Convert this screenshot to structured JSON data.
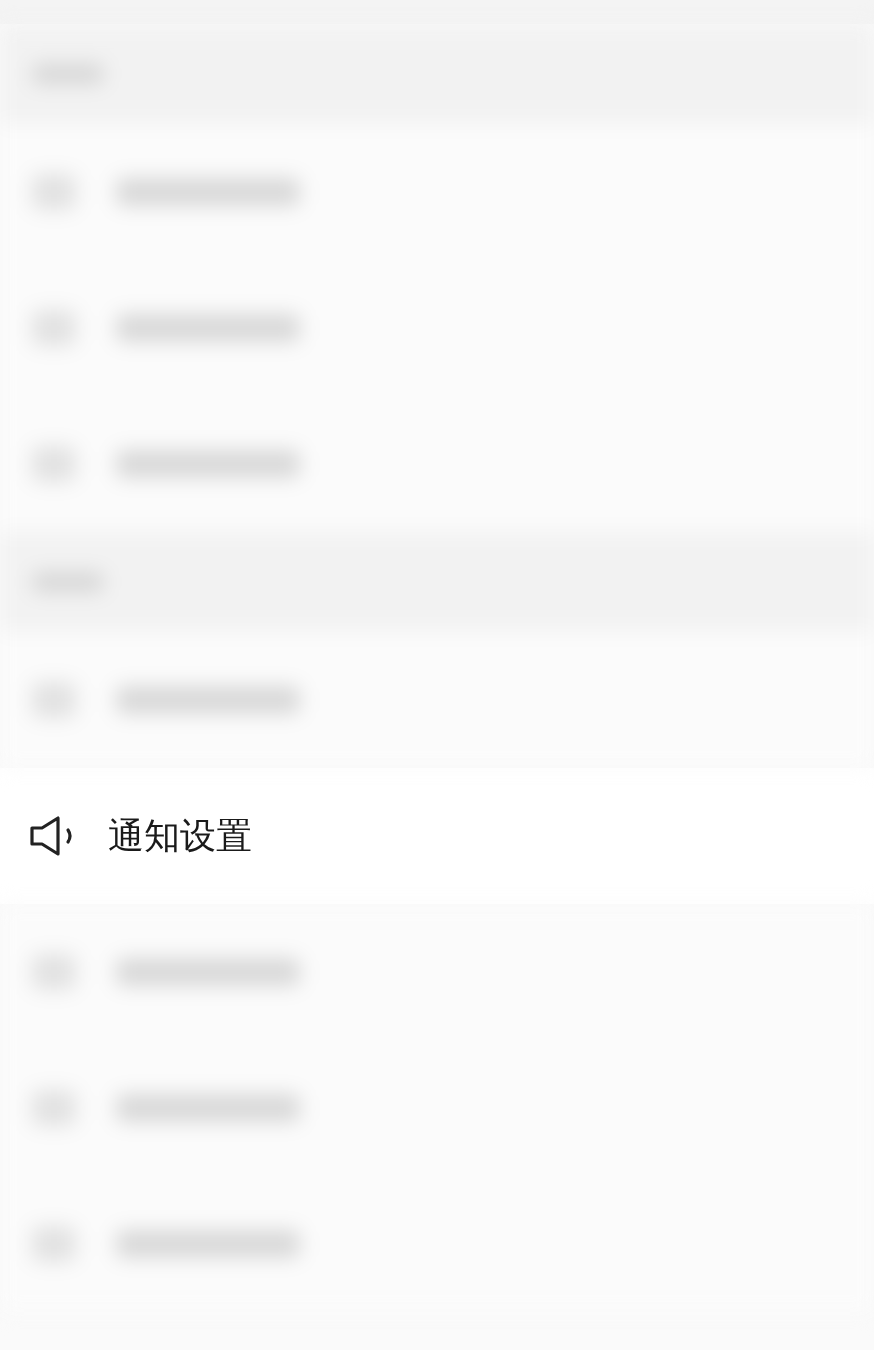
{
  "notification_row": {
    "label": "通知设置"
  }
}
